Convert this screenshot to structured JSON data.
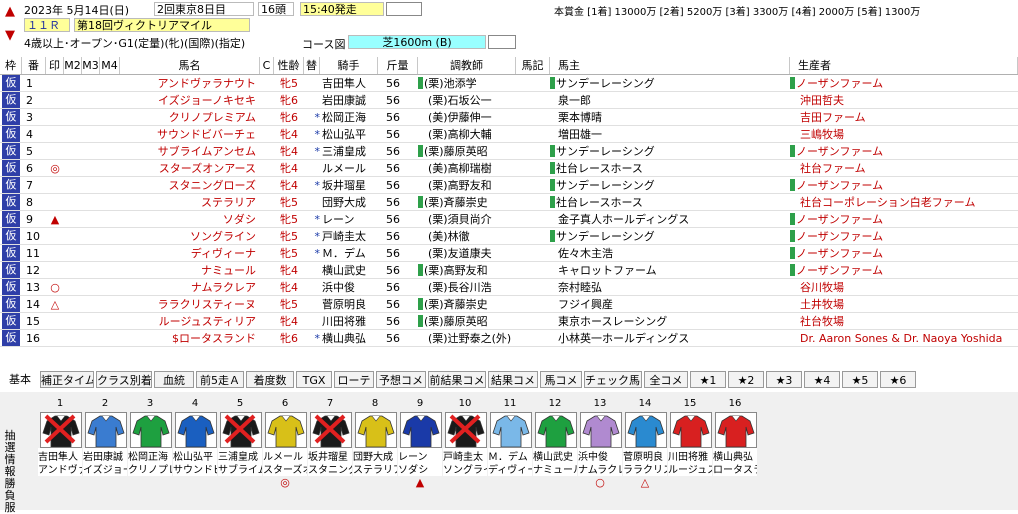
{
  "header": {
    "date": "2023年 5月14日(日)",
    "meeting": "2回東京8日目",
    "headcount": "16頭",
    "post_time": "15:40発走",
    "race_no": "１１Ｒ",
    "race_name": "第18回ヴィクトリアマイル",
    "conditions": "4歳以上･オープン･G1(定量)(牝)(国際)(指定)",
    "course_label": "コース図",
    "course": "芝1600m (B)",
    "prize": "本賞金 [1着] 13000万 [2着] 5200万 [3着] 3300万 [4着] 2000万 [5着] 1300万",
    "up_arrow": "▲",
    "down_arrow": "▼"
  },
  "columns": [
    "枠",
    "番",
    "印",
    "M2",
    "M3",
    "M4",
    "馬名",
    "C",
    "性齢",
    "替",
    "騎手",
    "斤量",
    "調教師",
    "馬記",
    "馬主",
    "生産者"
  ],
  "rows": [
    {
      "waku": "仮",
      "num": "1",
      "mark": "",
      "name": "アンドヴァラナウト",
      "sex": "牝5",
      "kae": "",
      "jockey": "吉田隼人",
      "weight": "56",
      "trainer": "(栗)池添学",
      "trainer_mark": true,
      "owner": "サンデーレーシング",
      "owner_mark": true,
      "breeder": "ノーザンファーム",
      "breeder_mark": true
    },
    {
      "waku": "仮",
      "num": "2",
      "mark": "",
      "name": "イズジョーノキセキ",
      "sex": "牝6",
      "kae": "",
      "jockey": "岩田康誠",
      "weight": "56",
      "trainer": "(栗)石坂公一",
      "trainer_mark": false,
      "owner": "泉一郎",
      "owner_mark": false,
      "breeder": "沖田哲夫",
      "breeder_mark": false
    },
    {
      "waku": "仮",
      "num": "3",
      "mark": "",
      "name": "クリノプレミアム",
      "sex": "牝6",
      "kae": "*",
      "jockey": "松岡正海",
      "weight": "56",
      "trainer": "(美)伊藤伸一",
      "trainer_mark": false,
      "owner": "栗本博晴",
      "owner_mark": false,
      "breeder": "吉田ファーム",
      "breeder_mark": false
    },
    {
      "waku": "仮",
      "num": "4",
      "mark": "",
      "name": "サウンドビバーチェ",
      "sex": "牝4",
      "kae": "*",
      "jockey": "松山弘平",
      "weight": "56",
      "trainer": "(栗)高柳大輔",
      "trainer_mark": false,
      "owner": "増田雄一",
      "owner_mark": false,
      "breeder": "三嶋牧場",
      "breeder_mark": false
    },
    {
      "waku": "仮",
      "num": "5",
      "mark": "",
      "name": "サブライムアンセム",
      "sex": "牝4",
      "kae": "*",
      "jockey": "三浦皇成",
      "weight": "56",
      "trainer": "(栗)藤原英昭",
      "trainer_mark": true,
      "owner": "サンデーレーシング",
      "owner_mark": true,
      "breeder": "ノーザンファーム",
      "breeder_mark": true
    },
    {
      "waku": "仮",
      "num": "6",
      "mark": "◎",
      "name": "スターズオンアース",
      "sex": "牝4",
      "kae": "",
      "jockey": "ルメール",
      "weight": "56",
      "trainer": "(美)高柳瑞樹",
      "trainer_mark": false,
      "owner": "社台レースホース",
      "owner_mark": true,
      "breeder": "社台ファーム",
      "breeder_mark": false
    },
    {
      "waku": "仮",
      "num": "7",
      "mark": "",
      "name": "スタニングローズ",
      "sex": "牝4",
      "kae": "*",
      "jockey": "坂井瑠星",
      "weight": "56",
      "trainer": "(栗)高野友和",
      "trainer_mark": false,
      "owner": "サンデーレーシング",
      "owner_mark": true,
      "breeder": "ノーザンファーム",
      "breeder_mark": true
    },
    {
      "waku": "仮",
      "num": "8",
      "mark": "",
      "name": "ステラリア",
      "sex": "牝5",
      "kae": "",
      "jockey": "団野大成",
      "weight": "56",
      "trainer": "(栗)斉藤崇史",
      "trainer_mark": true,
      "owner": "社台レースホース",
      "owner_mark": true,
      "breeder": "社台コーポレーション白老ファーム",
      "breeder_mark": false
    },
    {
      "waku": "仮",
      "num": "9",
      "mark": "▲",
      "name": "ソダシ",
      "sex": "牝5",
      "kae": "*",
      "jockey": "レーン",
      "weight": "56",
      "trainer": "(栗)須貝尚介",
      "trainer_mark": false,
      "owner": "金子真人ホールディングス",
      "owner_mark": false,
      "breeder": "ノーザンファーム",
      "breeder_mark": true
    },
    {
      "waku": "仮",
      "num": "10",
      "mark": "",
      "name": "ソングライン",
      "sex": "牝5",
      "kae": "*",
      "jockey": "戸崎圭太",
      "weight": "56",
      "trainer": "(美)林徹",
      "trainer_mark": false,
      "owner": "サンデーレーシング",
      "owner_mark": true,
      "breeder": "ノーザンファーム",
      "breeder_mark": true
    },
    {
      "waku": "仮",
      "num": "11",
      "mark": "",
      "name": "ディヴィーナ",
      "sex": "牝5",
      "kae": "*",
      "jockey": "Ｍ．デム",
      "weight": "56",
      "trainer": "(栗)友道康夫",
      "trainer_mark": false,
      "owner": "佐々木主浩",
      "owner_mark": false,
      "breeder": "ノーザンファーム",
      "breeder_mark": true
    },
    {
      "waku": "仮",
      "num": "12",
      "mark": "",
      "name": "ナミュール",
      "sex": "牝4",
      "kae": "",
      "jockey": "横山武史",
      "weight": "56",
      "trainer": "(栗)高野友和",
      "trainer_mark": true,
      "owner": "キャロットファーム",
      "owner_mark": false,
      "breeder": "ノーザンファーム",
      "breeder_mark": true
    },
    {
      "waku": "仮",
      "num": "13",
      "mark": "○",
      "name": "ナムラクレア",
      "sex": "牝4",
      "kae": "",
      "jockey": "浜中俊",
      "weight": "56",
      "trainer": "(栗)長谷川浩",
      "trainer_mark": false,
      "owner": "奈村睦弘",
      "owner_mark": false,
      "breeder": "谷川牧場",
      "breeder_mark": false
    },
    {
      "waku": "仮",
      "num": "14",
      "mark": "△",
      "name": "ララクリスティーヌ",
      "sex": "牝5",
      "kae": "",
      "jockey": "菅原明良",
      "weight": "56",
      "trainer": "(栗)斉藤崇史",
      "trainer_mark": true,
      "owner": "フジイ興産",
      "owner_mark": false,
      "breeder": "土井牧場",
      "breeder_mark": false
    },
    {
      "waku": "仮",
      "num": "15",
      "mark": "",
      "name": "ルージュスティリア",
      "sex": "牝4",
      "kae": "",
      "jockey": "川田将雅",
      "weight": "56",
      "trainer": "(栗)藤原英昭",
      "trainer_mark": true,
      "owner": "東京ホースレーシング",
      "owner_mark": false,
      "breeder": "社台牧場",
      "breeder_mark": false
    },
    {
      "waku": "仮",
      "num": "16",
      "mark": "",
      "name": "$ロータスランド",
      "sex": "牝6",
      "kae": "*",
      "jockey": "横山典弘",
      "weight": "56",
      "trainer": "(栗)辻野泰之(外)",
      "trainer_mark": false,
      "owner": "小林英一ホールディングス",
      "owner_mark": false,
      "breeder": "Dr. Aaron Sones & Dr. Naoya Yoshida",
      "breeder_mark": false
    }
  ],
  "tabs": [
    "基本",
    "補正タイム",
    "クラス別着",
    "血統",
    "前5走Ａ",
    "着度数",
    "TGX",
    "ローテ",
    "予想コメ",
    "前結果コメ",
    "結果コメ",
    "馬コメ",
    "チェック馬コメ",
    "全コメ",
    "★1",
    "★2",
    "★3",
    "★4",
    "★5",
    "★6"
  ],
  "bottom": {
    "vertical_label": "抽選情報 勝負服",
    "horses": [
      {
        "num": "1",
        "jockey": "吉田隼人",
        "horse": "アンドヴァ",
        "mark": "",
        "crossed": true,
        "silk": "#1a1a1a"
      },
      {
        "num": "2",
        "jockey": "岩田康誠",
        "horse": "イズジョー",
        "mark": "",
        "crossed": false,
        "silk": "#3a7cd0"
      },
      {
        "num": "3",
        "jockey": "松岡正海",
        "horse": "クリノプレ",
        "mark": "",
        "crossed": false,
        "silk": "#1ea040"
      },
      {
        "num": "4",
        "jockey": "松山弘平",
        "horse": "サウンドビ",
        "mark": "",
        "crossed": false,
        "silk": "#1a5fc0"
      },
      {
        "num": "5",
        "jockey": "三浦皇成",
        "horse": "サブライム",
        "mark": "",
        "crossed": true,
        "silk": "#1a1a1a"
      },
      {
        "num": "6",
        "jockey": "ルメール",
        "horse": "スターズオ",
        "mark": "◎",
        "crossed": false,
        "silk": "#d8c018"
      },
      {
        "num": "7",
        "jockey": "坂井瑠星",
        "horse": "スタニング",
        "mark": "",
        "crossed": true,
        "silk": "#1a1a1a"
      },
      {
        "num": "8",
        "jockey": "団野大成",
        "horse": "ステラリア",
        "mark": "",
        "crossed": false,
        "silk": "#d8c018"
      },
      {
        "num": "9",
        "jockey": "レーン",
        "horse": "ソダシ",
        "mark": "▲",
        "crossed": false,
        "silk": "#1a3aa8"
      },
      {
        "num": "10",
        "jockey": "戸崎圭太",
        "horse": "ソングライ",
        "mark": "",
        "crossed": true,
        "silk": "#1a1a1a"
      },
      {
        "num": "11",
        "jockey": "Ｍ．デム",
        "horse": "ディヴィー",
        "mark": "",
        "crossed": false,
        "silk": "#7ab8e8"
      },
      {
        "num": "12",
        "jockey": "横山武史",
        "horse": "ナミュール",
        "mark": "",
        "crossed": false,
        "silk": "#1ea040"
      },
      {
        "num": "13",
        "jockey": "浜中俊",
        "horse": "ナムラクレ",
        "mark": "○",
        "crossed": false,
        "silk": "#b08ad0"
      },
      {
        "num": "14",
        "jockey": "菅原明良",
        "horse": "ララクリス",
        "mark": "△",
        "crossed": false,
        "silk": "#2a8ad0"
      },
      {
        "num": "15",
        "jockey": "川田将雅",
        "horse": "ルージュス",
        "mark": "",
        "crossed": false,
        "silk": "#d82020"
      },
      {
        "num": "16",
        "jockey": "横山典弘",
        "horse": "ロータスラ",
        "mark": "",
        "crossed": false,
        "silk": "#d82020"
      }
    ]
  },
  "colors": {
    "waku": "#2f3fa8",
    "accent_red": "#c00000",
    "header_yellow": "#ffff99",
    "course_cyan": "#99ffff",
    "tab_bg": "#f3f3f3"
  }
}
